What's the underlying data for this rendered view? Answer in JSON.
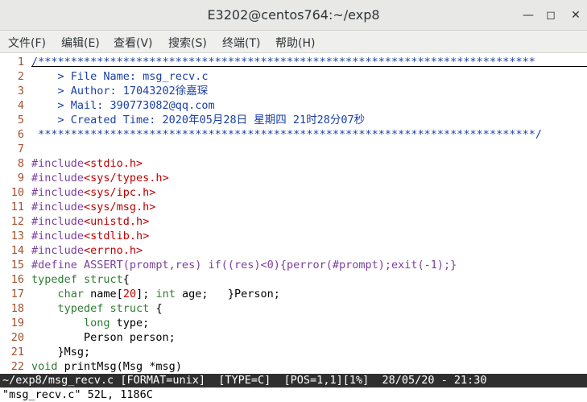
{
  "window": {
    "title": "E3202@centos764:~/exp8",
    "minimize_icon": "minimize-icon",
    "maximize_icon": "maximize-icon",
    "close_icon": "close-icon"
  },
  "menu": [
    "文件(F)",
    "编辑(E)",
    "查看(V)",
    "搜索(S)",
    "终端(T)",
    "帮助(H)"
  ],
  "code": [
    {
      "n": "1",
      "segs": [
        [
          "cm",
          "/****************************************************************************"
        ]
      ]
    },
    {
      "n": "2",
      "segs": [
        [
          "cm",
          "    > File Name: msg_recv.c"
        ]
      ]
    },
    {
      "n": "3",
      "segs": [
        [
          "cm",
          "    > Author: 17043202徐嘉琛"
        ]
      ]
    },
    {
      "n": "4",
      "segs": [
        [
          "cm",
          "    > Mail: 390773082@qq.com"
        ]
      ]
    },
    {
      "n": "5",
      "segs": [
        [
          "cm",
          "    > Created Time: 2020年05月28日 星期四 21时28分07秒"
        ]
      ]
    },
    {
      "n": "6",
      "segs": [
        [
          "cm",
          " ****************************************************************************/"
        ]
      ]
    },
    {
      "n": "7",
      "segs": []
    },
    {
      "n": "8",
      "segs": [
        [
          "pp",
          "#include"
        ],
        [
          "st",
          "<stdio.h>"
        ]
      ]
    },
    {
      "n": "9",
      "segs": [
        [
          "pp",
          "#include"
        ],
        [
          "st",
          "<sys/types.h>"
        ]
      ]
    },
    {
      "n": "10",
      "segs": [
        [
          "pp",
          "#include"
        ],
        [
          "st",
          "<sys/ipc.h>"
        ]
      ]
    },
    {
      "n": "11",
      "segs": [
        [
          "pp",
          "#include"
        ],
        [
          "st",
          "<sys/msg.h>"
        ]
      ]
    },
    {
      "n": "12",
      "segs": [
        [
          "pp",
          "#include"
        ],
        [
          "st",
          "<unistd.h>"
        ]
      ]
    },
    {
      "n": "13",
      "segs": [
        [
          "pp",
          "#include"
        ],
        [
          "st",
          "<stdlib.h>"
        ]
      ]
    },
    {
      "n": "14",
      "segs": [
        [
          "pp",
          "#include"
        ],
        [
          "st",
          "<errno.h>"
        ]
      ]
    },
    {
      "n": "15",
      "segs": [
        [
          "pp",
          "#define ASSERT(prompt,res) if((res)<0){perror(#prompt);exit(-1);}"
        ]
      ]
    },
    {
      "n": "16",
      "segs": [
        [
          "kw",
          "typedef struct"
        ],
        [
          "tx",
          "{"
        ]
      ]
    },
    {
      "n": "17",
      "segs": [
        [
          "tx",
          "    "
        ],
        [
          "ty",
          "char"
        ],
        [
          "tx",
          " name["
        ],
        [
          "st",
          "20"
        ],
        [
          "tx",
          "]; "
        ],
        [
          "ty",
          "int"
        ],
        [
          "tx",
          " age;   }Person;"
        ]
      ]
    },
    {
      "n": "18",
      "segs": [
        [
          "tx",
          "    "
        ],
        [
          "kw",
          "typedef struct"
        ],
        [
          "tx",
          " {"
        ]
      ]
    },
    {
      "n": "19",
      "segs": [
        [
          "tx",
          "        "
        ],
        [
          "ty",
          "long"
        ],
        [
          "tx",
          " type;"
        ]
      ]
    },
    {
      "n": "20",
      "segs": [
        [
          "tx",
          "        Person person;"
        ]
      ]
    },
    {
      "n": "21",
      "segs": [
        [
          "tx",
          "    }Msg;"
        ]
      ]
    },
    {
      "n": "22",
      "segs": [
        [
          "ty",
          "void"
        ],
        [
          "tx",
          " printMsg(Msg *msg)"
        ]
      ]
    }
  ],
  "status": {
    "path": "~/exp8/msg_recv.c",
    "format": "[FORMAT=unix]",
    "type": "[TYPE=C]",
    "pos": "[POS=1,1]",
    "pct": "[1%]",
    "datetime": "28/05/20 - 21:30"
  },
  "message": "\"msg_recv.c\" 52L, 1186C"
}
